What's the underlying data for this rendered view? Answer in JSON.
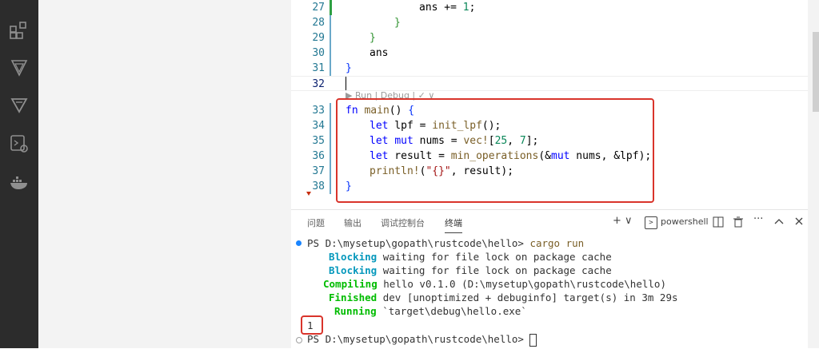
{
  "activity_icons": [
    "extensions-icon",
    "rust-analyzer-icon",
    "gitlens-icon",
    "remote-explorer-icon",
    "docker-icon"
  ],
  "editor": {
    "code_lines": [
      {
        "no": "27",
        "text": "ans += 1;"
      },
      {
        "no": "28",
        "text": "}"
      },
      {
        "no": "29",
        "text": "}"
      },
      {
        "no": "30",
        "text": "ans"
      },
      {
        "no": "31",
        "text": "}"
      },
      {
        "no": "32",
        "text": ""
      },
      {
        "no": "33",
        "text": "fn main() {"
      },
      {
        "no": "34",
        "text": "let lpf = init_lpf();"
      },
      {
        "no": "35",
        "text": "let mut nums = vec![25, 7];"
      },
      {
        "no": "36",
        "text": "let result = min_operations(&mut nums, &lpf);"
      },
      {
        "no": "37",
        "text": "println!(\"{}\", result);"
      },
      {
        "no": "38",
        "text": "}"
      }
    ],
    "codelens": "▶ Run | Debug | ✓ ∨"
  },
  "panel": {
    "tabs": [
      "问题",
      "输出",
      "调试控制台",
      "终端"
    ],
    "active_tab": "终端",
    "add_label": "+ ∨",
    "terminal_name": "powershell"
  },
  "terminal": {
    "prompt1": "PS D:\\mysetup\\gopath\\rustcode\\hello> ",
    "command": "cargo run",
    "lines": [
      {
        "status": "Blocking",
        "text": " waiting for file lock on package cache"
      },
      {
        "status": "Blocking",
        "text": " waiting for file lock on package cache"
      },
      {
        "status": "Compiling",
        "text": " hello v0.1.0 (D:\\mysetup\\gopath\\rustcode\\hello)"
      },
      {
        "status": "Finished",
        "text": " dev [unoptimized + debuginfo] target(s) in 3m 29s"
      },
      {
        "status": "Running",
        "text": " `target\\debug\\hello.exe`"
      }
    ],
    "output": "1",
    "prompt2": "PS D:\\mysetup\\gopath\\rustcode\\hello> "
  },
  "colors": {
    "highlight": "#d9342b",
    "blocking": "#0598bc",
    "compiling": "#00bc00"
  }
}
